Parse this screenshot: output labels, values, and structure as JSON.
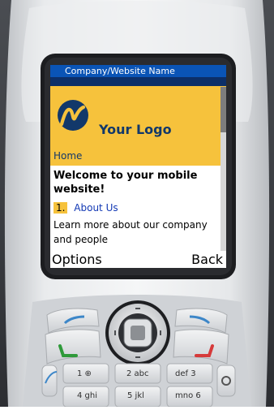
{
  "screen": {
    "status_title": "Company/Website Name",
    "logo_text": "Your Logo",
    "home_label": "Home",
    "welcome_text": "Welcome to your mobile website!",
    "about": {
      "number": "1.",
      "label": "About Us"
    },
    "description": "Learn more about our company and people",
    "softkeys": {
      "left": "Options",
      "right": "Back"
    }
  },
  "keypad": {
    "row1": [
      "1 ⊕",
      "2 abc",
      "def 3"
    ],
    "row2": [
      "4 ghi",
      "5 jkl",
      "mno 6"
    ]
  },
  "colors": {
    "accent_yellow": "#f6c23c",
    "brand_blue": "#0a54b6",
    "link_blue": "#1238b4",
    "phone_silver": "#d8dadd"
  }
}
